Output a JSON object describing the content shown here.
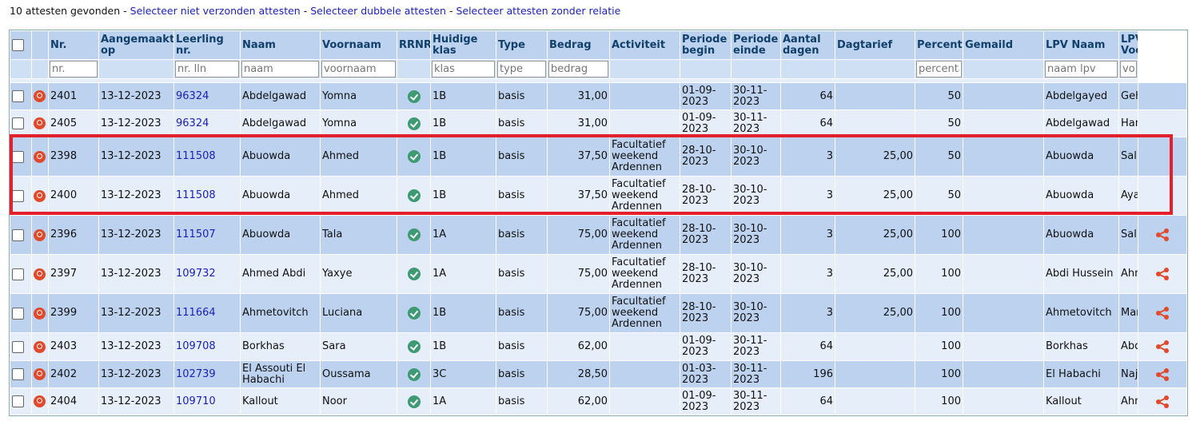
{
  "topbar": {
    "count_text": "10 attesten gevonden",
    "sep": " - ",
    "link1": "Selecteer niet verzonden attesten",
    "link2": "Selecteer dubbele attesten",
    "link3": "Selecteer attesten zonder relatie"
  },
  "columns": {
    "nr": "Nr.",
    "aangemaakt": "Aangemaakt op",
    "leerling": "Leerling nr.",
    "naam": "Naam",
    "voornaam": "Voornaam",
    "rrnr": "RRNR",
    "klas": "Huidige klas",
    "type": "Type",
    "bedrag": "Bedrag",
    "activiteit": "Activiteit",
    "begin": "Periode begin",
    "einde": "Periode einde",
    "dagen": "Aantal dagen",
    "dagtarief": "Dagtarief",
    "percentage": "Percentage",
    "gemaild": "Gemaild",
    "lpv_naam": "LPV Naam",
    "lpv_voornaam": "LPV Voornaam"
  },
  "filters": {
    "nr": "nr.",
    "leerling": "nr. lln",
    "naam": "naam",
    "voornaam": "voornaam",
    "klas": "klas",
    "type": "type",
    "bedrag": "bedrag",
    "percentage": "percentage",
    "lpv_naam": "naam lpv",
    "lpv_voornaam": "voornaam lpv"
  },
  "rows": [
    {
      "nr": "2401",
      "aangemaakt": "13-12-2023",
      "leerling": "96324",
      "naam": "Abdelgawad",
      "voornaam": "Yomna",
      "klas": "1B",
      "type": "basis",
      "bedrag": "31,00",
      "activiteit": "",
      "begin": "01-09-2023",
      "einde": "30-11-2023",
      "dagen": "64",
      "dagtarief": "",
      "percentage": "50",
      "gemaild": "",
      "lpv_naam": "Abdelgayed",
      "lpv_voornaam": "Gehad",
      "share": false
    },
    {
      "nr": "2405",
      "aangemaakt": "13-12-2023",
      "leerling": "96324",
      "naam": "Abdelgawad",
      "voornaam": "Yomna",
      "klas": "1B",
      "type": "basis",
      "bedrag": "31,00",
      "activiteit": "",
      "begin": "01-09-2023",
      "einde": "30-11-2023",
      "dagen": "64",
      "dagtarief": "",
      "percentage": "50",
      "gemaild": "",
      "lpv_naam": "Abdelgawad",
      "lpv_voornaam": "Hamada",
      "share": false
    },
    {
      "nr": "2398",
      "aangemaakt": "13-12-2023",
      "leerling": "111508",
      "naam": "Abuowda",
      "voornaam": "Ahmed",
      "klas": "1B",
      "type": "basis",
      "bedrag": "37,50",
      "activiteit": "Facultatief weekend Ardennen",
      "begin": "28-10-2023",
      "einde": "30-10-2023",
      "dagen": "3",
      "dagtarief": "25,00",
      "percentage": "50",
      "gemaild": "",
      "lpv_naam": "Abuowda",
      "lpv_voornaam": "Salim",
      "share": false
    },
    {
      "nr": "2400",
      "aangemaakt": "13-12-2023",
      "leerling": "111508",
      "naam": "Abuowda",
      "voornaam": "Ahmed",
      "klas": "1B",
      "type": "basis",
      "bedrag": "37,50",
      "activiteit": "Facultatief weekend Ardennen",
      "begin": "28-10-2023",
      "einde": "30-10-2023",
      "dagen": "3",
      "dagtarief": "25,00",
      "percentage": "50",
      "gemaild": "",
      "lpv_naam": "Abuowda",
      "lpv_voornaam": "Ayah",
      "share": false
    },
    {
      "nr": "2396",
      "aangemaakt": "13-12-2023",
      "leerling": "111507",
      "naam": "Abuowda",
      "voornaam": "Tala",
      "klas": "1A",
      "type": "basis",
      "bedrag": "75,00",
      "activiteit": "Facultatief weekend Ardennen",
      "begin": "28-10-2023",
      "einde": "30-10-2023",
      "dagen": "3",
      "dagtarief": "25,00",
      "percentage": "100",
      "gemaild": "",
      "lpv_naam": "Abuowda",
      "lpv_voornaam": "Salim",
      "share": true
    },
    {
      "nr": "2397",
      "aangemaakt": "13-12-2023",
      "leerling": "109732",
      "naam": "Ahmed Abdi",
      "voornaam": "Yaxye",
      "klas": "1A",
      "type": "basis",
      "bedrag": "75,00",
      "activiteit": "Facultatief weekend Ardennen",
      "begin": "28-10-2023",
      "einde": "30-10-2023",
      "dagen": "3",
      "dagtarief": "25,00",
      "percentage": "100",
      "gemaild": "",
      "lpv_naam": "Abdi Hussein",
      "lpv_voornaam": "Ahmed",
      "share": true
    },
    {
      "nr": "2399",
      "aangemaakt": "13-12-2023",
      "leerling": "111664",
      "naam": "Ahmetovitch",
      "voornaam": "Luciana",
      "klas": "1B",
      "type": "basis",
      "bedrag": "75,00",
      "activiteit": "Facultatief weekend Ardennen",
      "begin": "28-10-2023",
      "einde": "30-10-2023",
      "dagen": "3",
      "dagtarief": "25,00",
      "percentage": "100",
      "gemaild": "",
      "lpv_naam": "Ahmetovitch",
      "lpv_voornaam": "Mariana",
      "share": true
    },
    {
      "nr": "2403",
      "aangemaakt": "13-12-2023",
      "leerling": "109708",
      "naam": "Borkhas",
      "voornaam": "Sara",
      "klas": "1B",
      "type": "basis",
      "bedrag": "62,00",
      "activiteit": "",
      "begin": "01-09-2023",
      "einde": "30-11-2023",
      "dagen": "64",
      "dagtarief": "",
      "percentage": "100",
      "gemaild": "",
      "lpv_naam": "Borkhas",
      "lpv_voornaam": "Abdelmajid",
      "share": true
    },
    {
      "nr": "2402",
      "aangemaakt": "13-12-2023",
      "leerling": "102739",
      "naam": "El Assouti El Habachi",
      "voornaam": "Oussama",
      "klas": "3C",
      "type": "basis",
      "bedrag": "28,50",
      "activiteit": "",
      "begin": "01-03-2023",
      "einde": "30-11-2023",
      "dagen": "196",
      "dagtarief": "",
      "percentage": "100",
      "gemaild": "",
      "lpv_naam": "El Habachi",
      "lpv_voornaam": "Najima",
      "share": true
    },
    {
      "nr": "2404",
      "aangemaakt": "13-12-2023",
      "leerling": "109710",
      "naam": "Kallout",
      "voornaam": "Noor",
      "klas": "1A",
      "type": "basis",
      "bedrag": "62,00",
      "activiteit": "",
      "begin": "01-09-2023",
      "einde": "30-11-2023",
      "dagen": "64",
      "dagtarief": "",
      "percentage": "100",
      "gemaild": "",
      "lpv_naam": "Kallout",
      "lpv_voornaam": "Ahmed",
      "share": true
    }
  ],
  "colors": {
    "header_bg": "#bcd2ef",
    "row_odd": "#bcd2ef",
    "row_even": "#e6eef9",
    "link": "#1a1fb8",
    "highlight": "#e3202c",
    "share": "#e04a2a"
  }
}
